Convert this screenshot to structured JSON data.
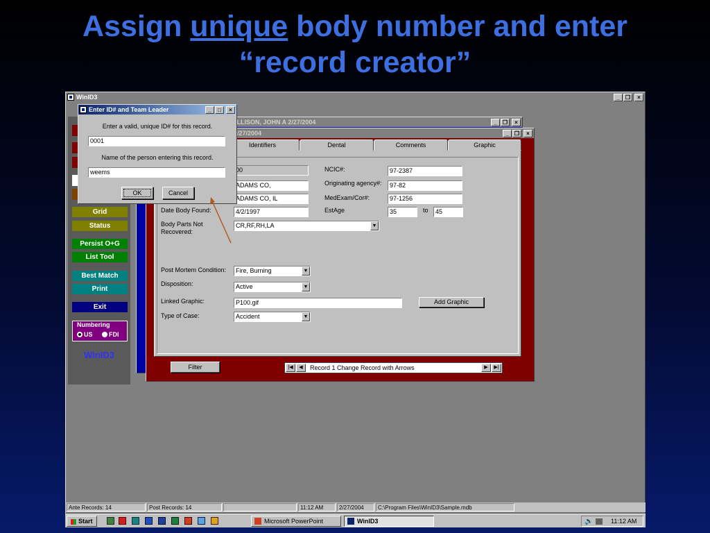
{
  "slide": {
    "title_before": "Assign ",
    "title_underlined": "unique",
    "title_after": " body number and enter",
    "title_line2": "“record creator”"
  },
  "main_window": {
    "title": "WinID3"
  },
  "sidebar": {
    "buttons": [
      {
        "label": "Grid",
        "color": "#808000"
      },
      {
        "label": "Status",
        "color": "#808000"
      },
      {
        "label": "Persist O+G",
        "color": "#008000"
      },
      {
        "label": "List Tool",
        "color": "#008000"
      },
      {
        "label": "Best Match",
        "color": "#008080"
      },
      {
        "label": "Print",
        "color": "#008080"
      },
      {
        "label": "Exit",
        "color": "#000080"
      }
    ],
    "numbering": {
      "title": "Numbering",
      "option_us": "US",
      "option_fdi": "FDI",
      "selected": "US"
    },
    "logo": "WinID3"
  },
  "back_window": {
    "title": "ALLISON, JOHN A  2/27/2004"
  },
  "record_window": {
    "title": "2/27/2004",
    "tabs": [
      "Identifiers",
      "Dental",
      "Comments",
      "Graphic"
    ],
    "fields": {
      "id_value": "00",
      "name_value": "ADAMS CO,",
      "location_value": "ADAMS CO, IL",
      "date_body_found_label": "Date Body Found:",
      "date_body_found": "4/2/1997",
      "body_parts_label": "Body Parts Not Recovered:",
      "body_parts": "CR,RF,RH,LA",
      "ncic_label": "NCIC#:",
      "ncic": "97-2387",
      "orig_agency_label": "Originating agency#:",
      "orig_agency": "97-82",
      "medexam_label": "MedExam/Cor#:",
      "medexam": "97-1256",
      "estage_label": "EstAge",
      "estage_from": "35",
      "estage_to_label": "to",
      "estage_to": "45",
      "pm_condition_label": "Post Mortem Condition:",
      "pm_condition": "Fire, Burning",
      "disposition_label": "Disposition:",
      "disposition": "Active",
      "linked_graphic_label": "Linked Graphic:",
      "linked_graphic": "P100.gif",
      "add_graphic": "Add Graphic",
      "type_of_case_label": "Type of Case:",
      "type_of_case": "Accident"
    },
    "filter_button": "Filter",
    "nav_text": "Record 1   Change Record with Arrows"
  },
  "dialog": {
    "title": "Enter ID# and Team Leader",
    "prompt_id": "Enter a valid, unique ID# for this record.",
    "id_value": "0001",
    "prompt_name": "Name of the person entering this record.",
    "name_value": "weems",
    "ok": "OK",
    "cancel": "Cancel"
  },
  "statusbar": {
    "ante": "Ante Records: 14",
    "post": "Post Records: 14",
    "time": "11:12 AM",
    "date": "2/27/2004",
    "path": "C:\\Program Files\\WinID3\\Sample.mdb"
  },
  "taskbar": {
    "start": "Start",
    "tasks": [
      "Microsoft PowerPoint",
      "WinID3"
    ],
    "clock": "11:12 AM"
  }
}
